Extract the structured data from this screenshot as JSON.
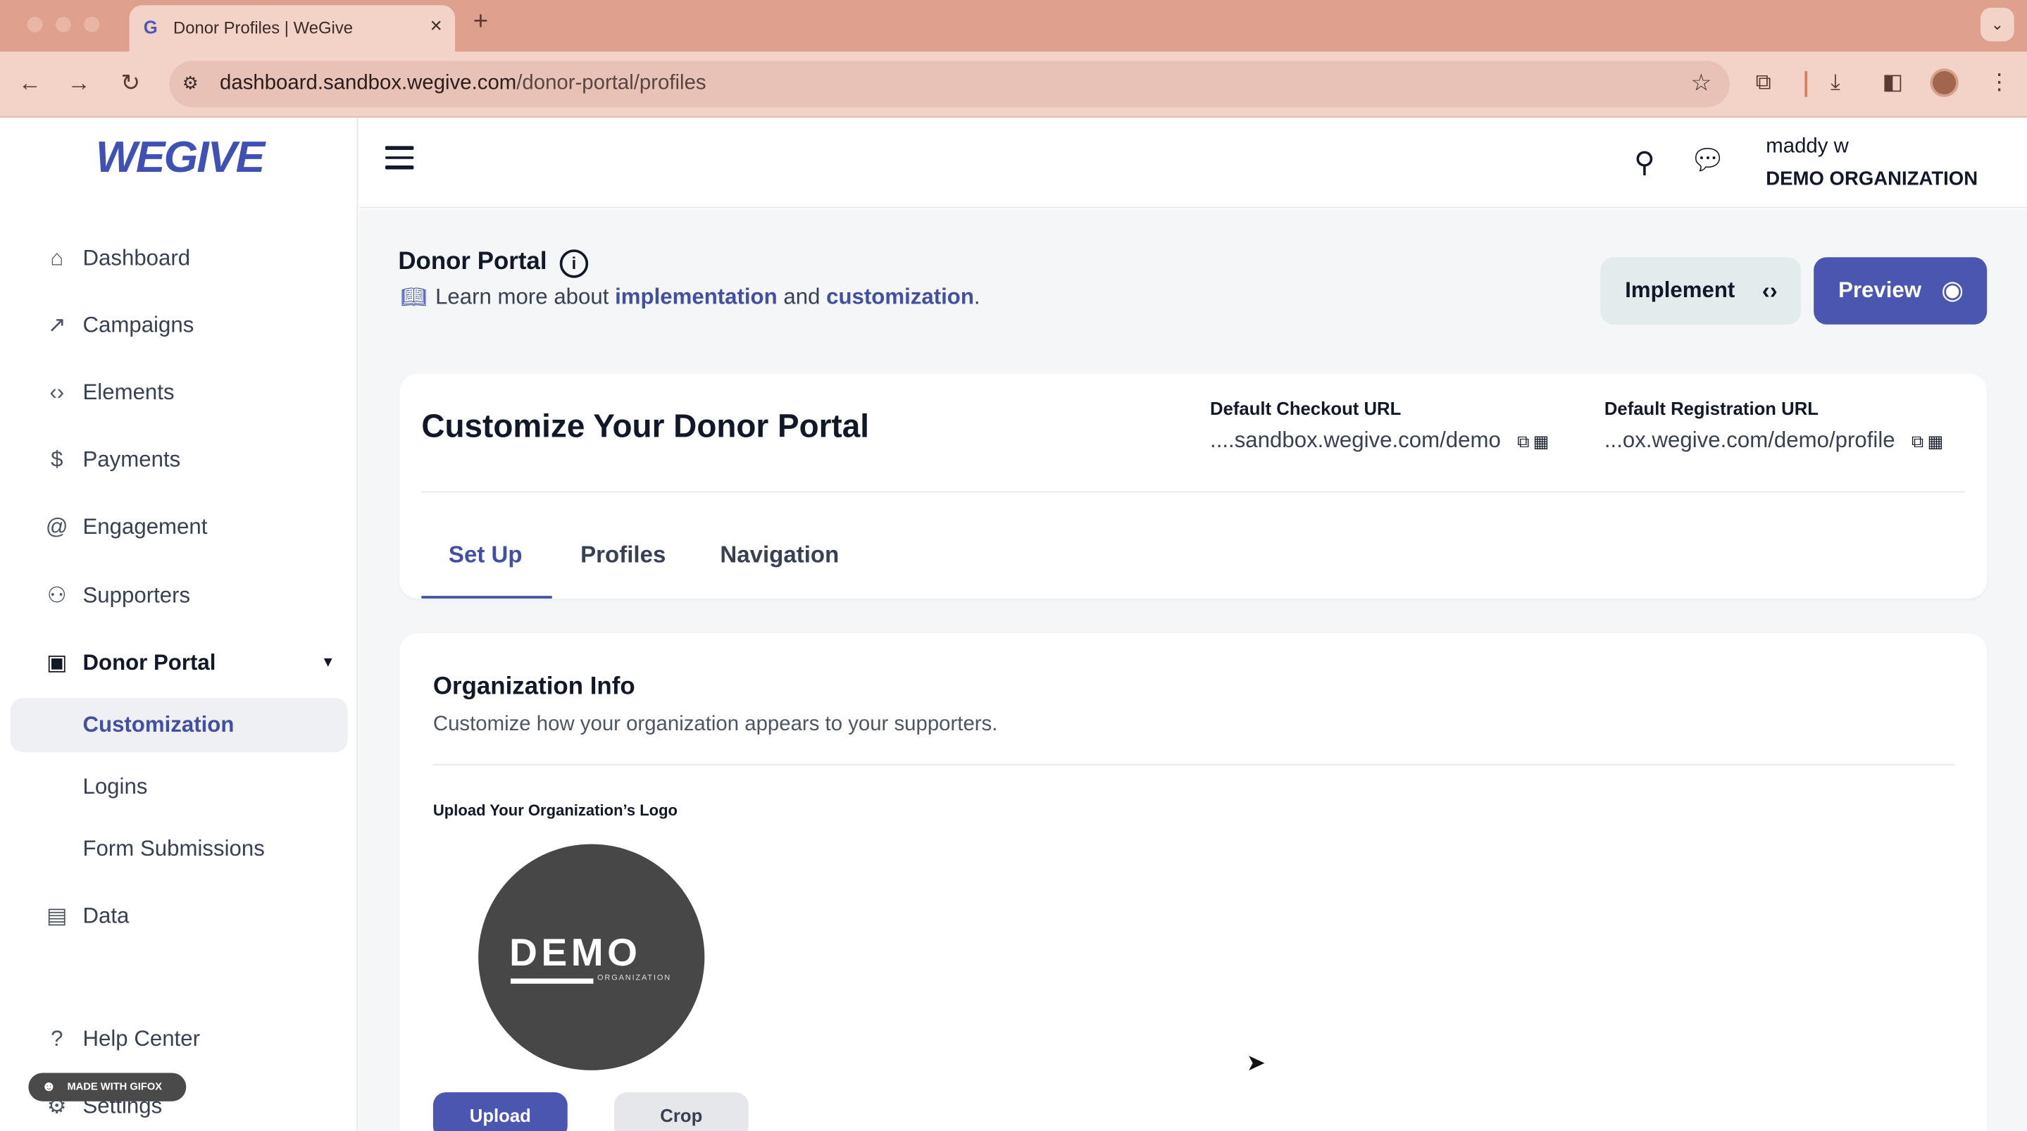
{
  "browser": {
    "tab_title": "Donor Profiles | WeGive",
    "tab_favicon": "G",
    "new_tab": "+",
    "tab_close": "×",
    "tab_menu": "⌄",
    "url_host": "dashboard.sandbox.wegive.com",
    "url_path": "/donor-portal/profiles"
  },
  "app": {
    "logo_text": "WEGIVE",
    "user_name": "maddy w",
    "organization": "DEMO ORGANIZATION"
  },
  "sidebar": {
    "items": [
      {
        "label": "Dashboard",
        "icon": "home-icon",
        "glyph": "⌂"
      },
      {
        "label": "Campaigns",
        "icon": "trending-icon",
        "glyph": "↗"
      },
      {
        "label": "Elements",
        "icon": "code-icon",
        "glyph": "‹›"
      },
      {
        "label": "Payments",
        "icon": "dollar-icon",
        "glyph": "$"
      },
      {
        "label": "Engagement",
        "icon": "at-icon",
        "glyph": "@"
      },
      {
        "label": "Supporters",
        "icon": "users-icon",
        "glyph": "⚇"
      },
      {
        "label": "Donor Portal",
        "icon": "portal-icon",
        "glyph": "▣"
      },
      {
        "label": "Customization"
      },
      {
        "label": "Logins"
      },
      {
        "label": "Form Submissions"
      },
      {
        "label": "Data",
        "icon": "data-icon",
        "glyph": "▤"
      },
      {
        "label": "Help Center",
        "icon": "help-icon",
        "glyph": "?"
      },
      {
        "label": "Settings",
        "icon": "gear-icon",
        "glyph": "⚙"
      }
    ],
    "badge": "MADE WITH GIFOX"
  },
  "header": {
    "title": "Donor Portal",
    "learn_prefix": "Learn more about",
    "link_implementation": "implementation",
    "learn_and": "and",
    "link_customization": "customization",
    "learn_suffix": ".",
    "implement_label": "Implement",
    "preview_label": "Preview"
  },
  "customize_card": {
    "title": "Customize Your Donor Portal",
    "checkout_label": "Default Checkout URL",
    "checkout_value": "....sandbox.wegive.com/demo",
    "registration_label": "Default Registration URL",
    "registration_value": "...ox.wegive.com/demo/profile",
    "tabs": [
      "Set Up",
      "Profiles",
      "Navigation"
    ]
  },
  "org_info": {
    "title": "Organization Info",
    "subtitle": "Customize how your organization appears to your supporters.",
    "logo_label": "Upload Your Organization’s Logo",
    "logo_word": "DEMO",
    "logo_small": "ORGANIZATION",
    "upload_label": "Upload",
    "crop_label": "Crop"
  },
  "colors": {
    "brand": "#4250a3",
    "primary_button": "#4a56b0",
    "browser_frame": "#dfa08d"
  }
}
